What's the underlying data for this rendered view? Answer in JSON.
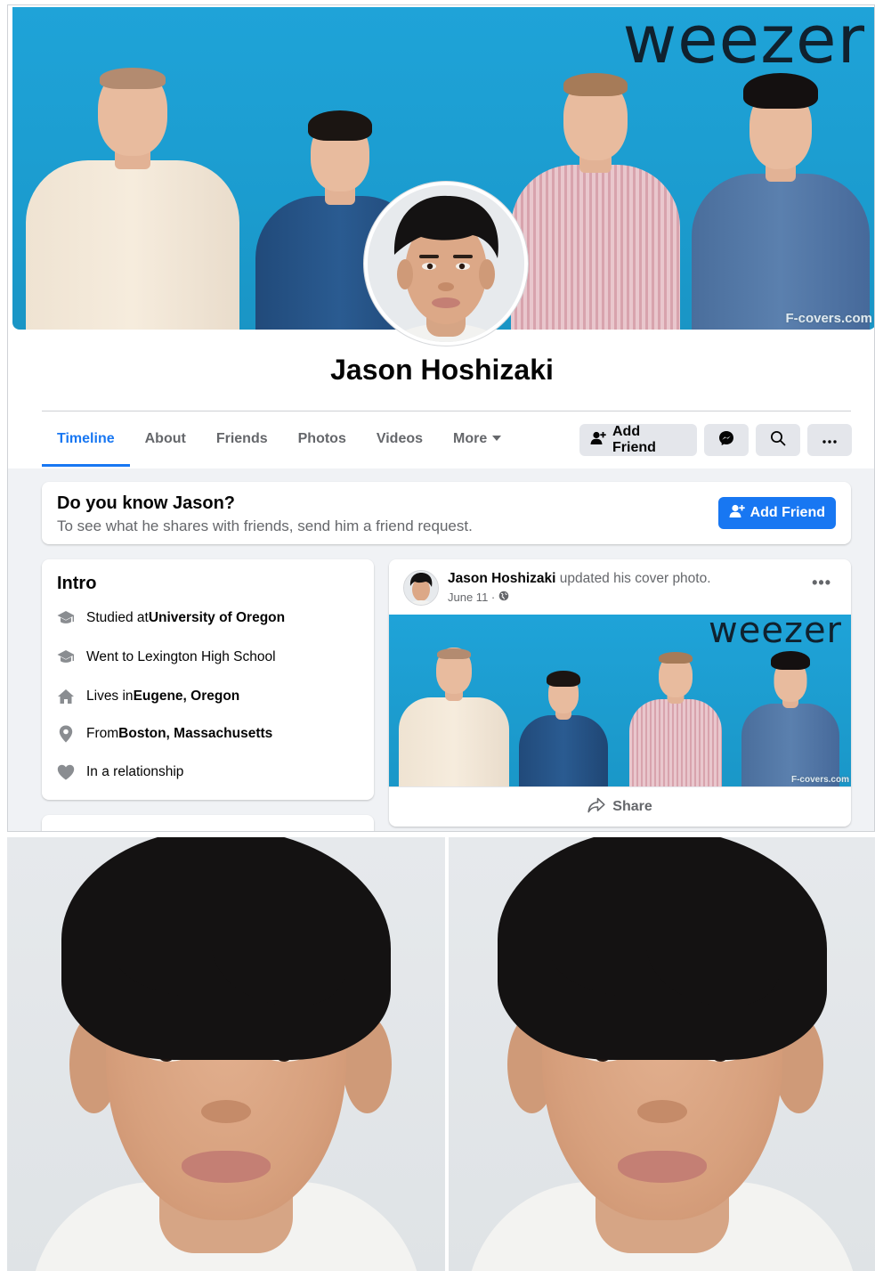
{
  "cover": {
    "wordmark": "weezer",
    "credit": "F-covers.com"
  },
  "profile": {
    "name": "Jason Hoshizaki"
  },
  "tabs": [
    {
      "label": "Timeline",
      "active": true
    },
    {
      "label": "About",
      "active": false
    },
    {
      "label": "Friends",
      "active": false
    },
    {
      "label": "Photos",
      "active": false
    },
    {
      "label": "Videos",
      "active": false
    },
    {
      "label": "More",
      "active": false
    }
  ],
  "actions": {
    "add_friend_label": "Add Friend",
    "icons": [
      "add-user-icon",
      "messenger-icon",
      "search-icon",
      "more-icon"
    ]
  },
  "know_card": {
    "title": "Do you know Jason?",
    "subtitle": "To see what he shares with friends, send him a friend request.",
    "button_label": "Add Friend"
  },
  "intro": {
    "title": "Intro",
    "rows": [
      {
        "icon": "graduation-cap-icon",
        "prefix": "Studied at ",
        "bold": "University of Oregon"
      },
      {
        "icon": "graduation-cap-icon",
        "prefix": "Went to Lexington High School",
        "bold": ""
      },
      {
        "icon": "home-icon",
        "prefix": "Lives in ",
        "bold": "Eugene, Oregon"
      },
      {
        "icon": "location-pin-icon",
        "prefix": "From ",
        "bold": "Boston, Massachusetts"
      },
      {
        "icon": "heart-icon",
        "prefix": "In a relationship",
        "bold": ""
      }
    ]
  },
  "post": {
    "author": "Jason Hoshizaki",
    "action": " updated his cover photo.",
    "date": "June 11 ·",
    "more": "•••",
    "share_label": "Share",
    "image_wordmark": "weezer",
    "image_credit": "F-covers.com"
  },
  "colors": {
    "facebook_blue": "#1877f2",
    "cover_blue": "#1fa3d8",
    "button_grey": "#e4e6eb",
    "page_background": "#f0f2f5",
    "secondary_text": "#65676b"
  }
}
